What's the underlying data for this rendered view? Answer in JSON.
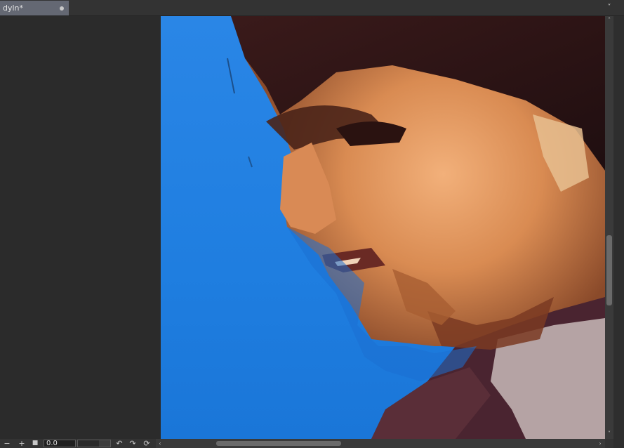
{
  "tabs": [
    {
      "label": "dyln*",
      "modified": true
    }
  ],
  "icons": {
    "tab_modified": "dot-icon",
    "tab_menu": "chevron-down-icon",
    "zoom_out": "minus-icon",
    "zoom_in": "plus-icon",
    "stop": "square-stop-icon",
    "rotate_left": "rotate-ccw-icon",
    "rotate_right": "rotate-cw-icon",
    "reset_rotation": "reset-rotation-icon",
    "scroll_left": "chevron-left-icon",
    "scroll_right": "chevron-right-icon",
    "scroll_up": "chevron-up-icon",
    "scroll_down": "chevron-down-icon"
  },
  "glyphs": {
    "minus": "−",
    "plus": "+",
    "stop": "■",
    "rotate_left": "↶",
    "rotate_right": "↷",
    "reset": "⟳",
    "left": "‹",
    "right": "›",
    "up": "˄",
    "down": "˅",
    "menu": "˅"
  },
  "statusbar": {
    "rotation_value": "0.0"
  },
  "colors": {
    "background_blue": "#1f7ee0",
    "tab_active": "#646873",
    "panel": "#2b2b2b"
  }
}
